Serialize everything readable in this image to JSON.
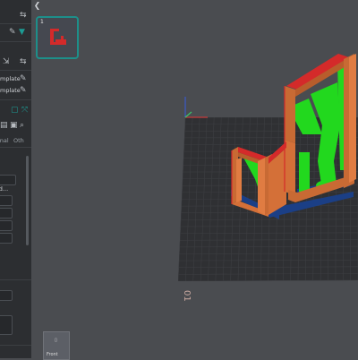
{
  "sidebar": {
    "template_rows": [
      {
        "label": "emplate"
      },
      {
        "label": "emplate"
      }
    ],
    "tabs": [
      "lanal",
      "Oth"
    ],
    "fields": [
      "id..."
    ]
  },
  "plate": {
    "number": "1"
  },
  "viewport": {
    "plate_label": "01"
  },
  "nav_cube": {
    "face": "Front"
  },
  "colors": {
    "bed": "#2f3033",
    "grid": "#3d3e42",
    "model_orange": "#c86a34",
    "support_green": "#22d81e",
    "brim_blue": "#1b3f86",
    "seam_red": "#d42a2a",
    "accent": "#1d8f8a"
  }
}
